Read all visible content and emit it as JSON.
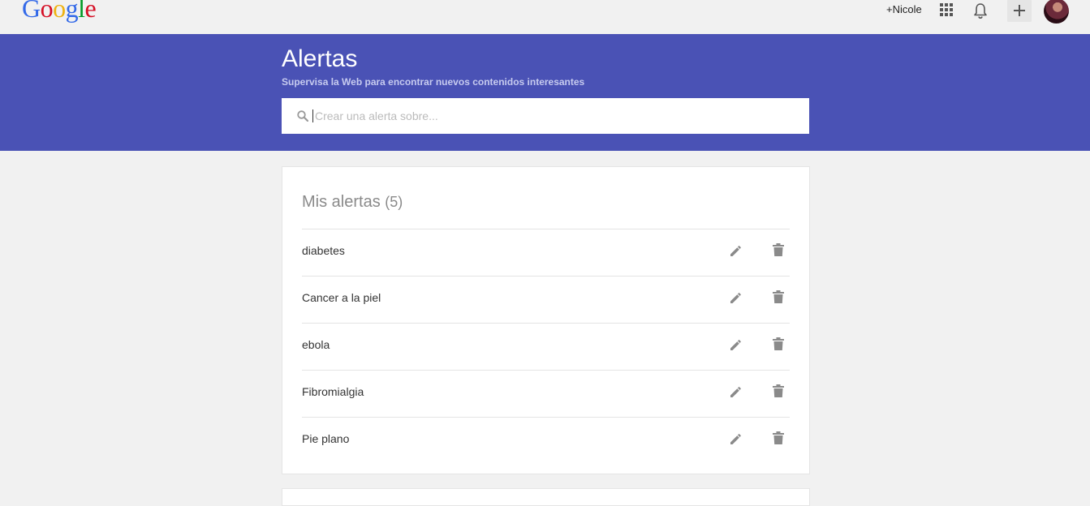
{
  "topbar": {
    "logo_letters": [
      {
        "ch": "G",
        "color": "#3369e8"
      },
      {
        "ch": "o",
        "color": "#d50f25"
      },
      {
        "ch": "o",
        "color": "#eeb211"
      },
      {
        "ch": "g",
        "color": "#3369e8"
      },
      {
        "ch": "l",
        "color": "#009925"
      },
      {
        "ch": "e",
        "color": "#d50f25"
      }
    ],
    "user_link": "+Nicole",
    "icons": [
      "apps-grid-icon",
      "notifications-bell-icon",
      "plus-icon",
      "avatar"
    ]
  },
  "header": {
    "title": "Alertas",
    "subtitle": "Supervisa la Web para encontrar nuevos contenidos interesantes",
    "background_color": "#4a52b5",
    "search": {
      "placeholder": "Crear una alerta sobre...",
      "value": ""
    }
  },
  "alerts": {
    "title": "Mis alertas",
    "count": "(5)",
    "items": [
      {
        "label": "diabetes"
      },
      {
        "label": "Cancer a la piel"
      },
      {
        "label": "ebola"
      },
      {
        "label": "Fibromialgia"
      },
      {
        "label": "Pie plano"
      }
    ],
    "item_icons": [
      "pencil-icon",
      "trash-icon"
    ]
  }
}
